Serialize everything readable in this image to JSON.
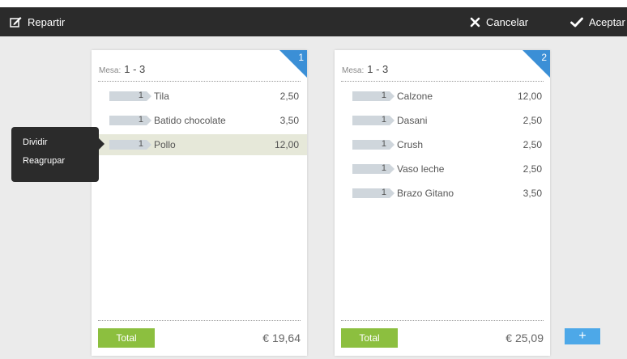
{
  "toolbar": {
    "split_label": "Repartir",
    "cancel_label": "Cancelar",
    "accept_label": "Aceptar"
  },
  "context_menu": {
    "items": [
      "Dividir",
      "Reagrupar"
    ]
  },
  "tickets": [
    {
      "number": "1",
      "table_label": "Mesa:",
      "table_value": "1 - 3",
      "lines": [
        {
          "qty": "1",
          "name": "Tila",
          "price": "2,50"
        },
        {
          "qty": "1",
          "name": "Batido chocolate",
          "price": "3,50"
        },
        {
          "qty": "1",
          "name": "Pollo",
          "price": "12,00"
        }
      ],
      "total_label": "Total",
      "total": "€ 19,64"
    },
    {
      "number": "2",
      "table_label": "Mesa:",
      "table_value": "1 - 3",
      "lines": [
        {
          "qty": "1",
          "name": "Calzone",
          "price": "12,00"
        },
        {
          "qty": "1",
          "name": "Dasani",
          "price": "2,50"
        },
        {
          "qty": "1",
          "name": "Crush",
          "price": "2,50"
        },
        {
          "qty": "1",
          "name": "Vaso leche",
          "price": "2,50"
        },
        {
          "qty": "1",
          "name": "Brazo Gitano",
          "price": "3,50"
        }
      ],
      "total_label": "Total",
      "total": "€ 25,09"
    }
  ],
  "add_ticket_label": "+",
  "colors": {
    "topbar": "#2b2b2b",
    "corner_badge": "#3b8fd6",
    "total_button": "#8cbf3f",
    "add_button": "#4da8e8",
    "selected_row": "#e6e8d9"
  },
  "icons": {
    "split": "edit-icon",
    "cancel": "close-icon",
    "accept": "check-icon"
  }
}
